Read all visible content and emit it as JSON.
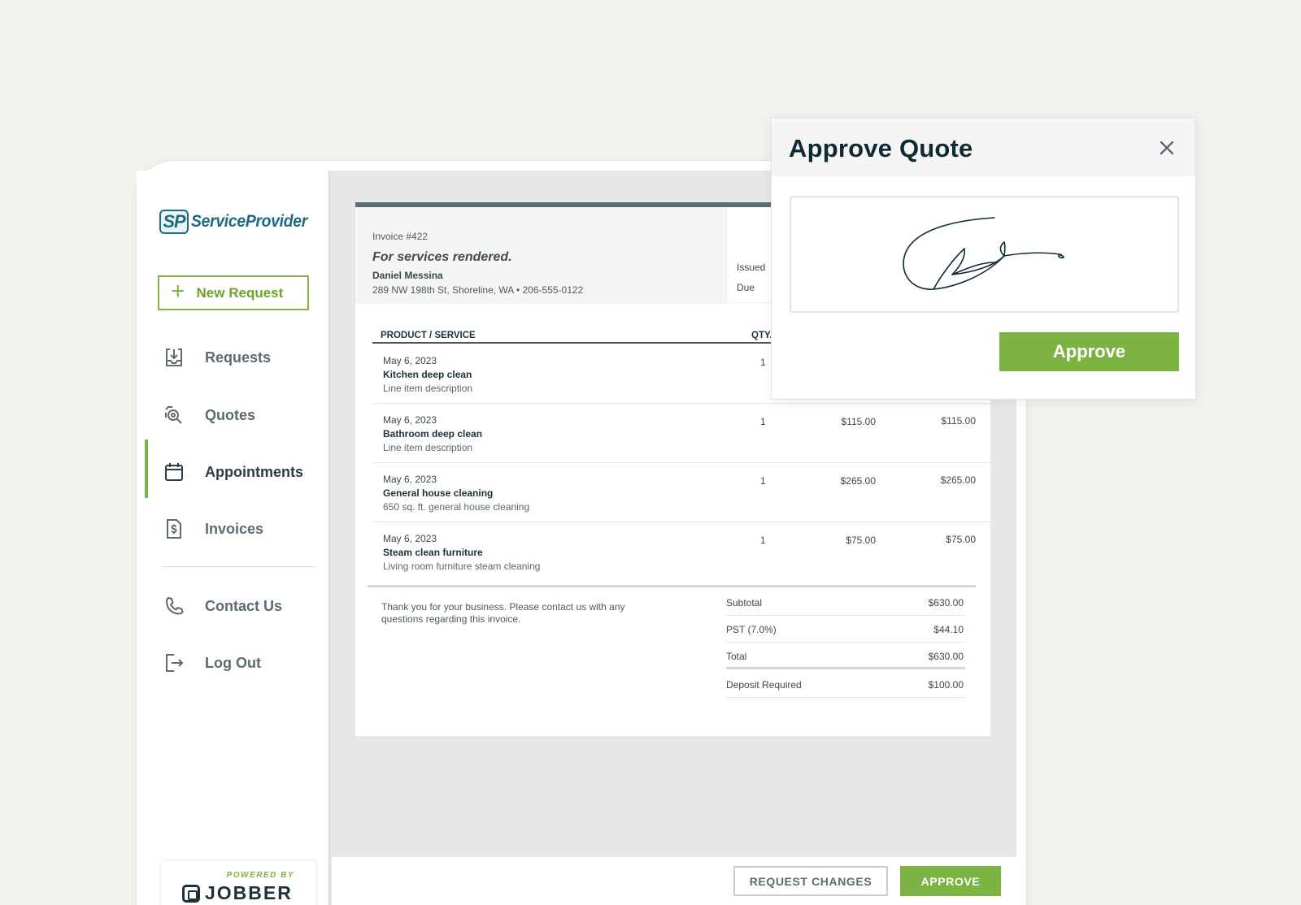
{
  "brand": {
    "logo_badge": "SP",
    "logo_name": "ServiceProvider",
    "accent_color": "#7db343",
    "text_color": "#1f3138"
  },
  "sidebar": {
    "new_request_label": "New Request",
    "items": [
      {
        "label": "Requests",
        "icon": "inbox-download-icon"
      },
      {
        "label": "Quotes",
        "icon": "quote-search-icon"
      },
      {
        "label": "Appointments",
        "icon": "calendar-icon",
        "active": true
      },
      {
        "label": "Invoices",
        "icon": "invoice-dollar-icon"
      },
      {
        "label": "Contact Us",
        "icon": "phone-icon"
      },
      {
        "label": "Log Out",
        "icon": "logout-icon"
      }
    ],
    "powered_by": "POWERED BY",
    "powered_brand": "JOBBER"
  },
  "invoice": {
    "number": "Invoice #422",
    "title": "For services rendered.",
    "client_name": "Daniel Messina",
    "client_address": "289 NW 198th St, Shoreline, WA  •  206-555-0122",
    "issued_label": "Issued",
    "due_label": "Due",
    "columns": {
      "product": "PRODUCT / SERVICE",
      "qty": "QTY."
    },
    "line_items": [
      {
        "date": "May 6, 2023",
        "name": "Kitchen deep clean",
        "description": "Line item description",
        "qty": "1",
        "unit": "",
        "total": ""
      },
      {
        "date": "May 6, 2023",
        "name": "Bathroom deep clean",
        "description": "Line item description",
        "qty": "1",
        "unit": "$115.00",
        "total": "$115.00"
      },
      {
        "date": "May 6, 2023",
        "name": "General house cleaning",
        "description": "650 sq. ft. general house cleaning",
        "qty": "1",
        "unit": "$265.00",
        "total": "$265.00"
      },
      {
        "date": "May 6, 2023",
        "name": "Steam clean furniture",
        "description": "Living room furniture steam cleaning",
        "qty": "1",
        "unit": "$75.00",
        "total": "$75.00"
      }
    ],
    "thanks": "Thank you for your business. Please contact us with any questions regarding this invoice.",
    "summary": [
      {
        "label": "Subtotal",
        "value": "$630.00"
      },
      {
        "label": "PST (7.0%)",
        "value": "$44.10"
      },
      {
        "label": "Total",
        "value": "$630.00"
      },
      {
        "label": "Deposit Required",
        "value": "$100.00"
      }
    ]
  },
  "footer": {
    "request_changes": "REQUEST CHANGES",
    "approve": "APPROVE"
  },
  "modal": {
    "title": "Approve Quote",
    "approve": "Approve",
    "close_icon": "close-icon"
  }
}
